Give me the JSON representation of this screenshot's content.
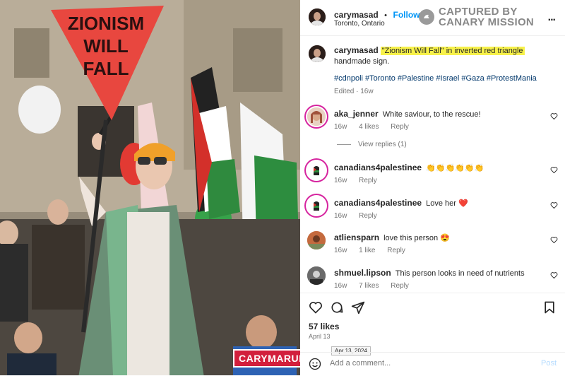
{
  "photo": {
    "sign_lines": [
      "ZIONISM",
      "WILL",
      "FALL"
    ],
    "watermark": "CARYMARULES"
  },
  "header": {
    "username": "carymasad",
    "separator": "•",
    "follow_label": "Follow",
    "location": "Toronto, Ontario",
    "canary_lines": [
      "CAPTURED BY",
      "CANARY MISSION"
    ],
    "more_label": "..."
  },
  "caption": {
    "username": "carymasad",
    "highlight": "\"Zionism Will Fall\" in inverted red triangle",
    "rest": " handmade sign.",
    "hashtags": "#cdnpoli #Toronto #Palestine #Israel #Gaza #ProtestMania",
    "edited": "Edited · 16w"
  },
  "comments": [
    {
      "user": "aka_jenner",
      "text": "White saviour, to the rescue!",
      "time": "16w",
      "likes": "4 likes",
      "reply": "Reply"
    },
    {
      "user": "canadians4palestinee",
      "text": "👏👏👏👏👏👏",
      "time": "16w",
      "likes": "",
      "reply": "Reply"
    },
    {
      "user": "canadians4palestinee",
      "text": "Love her ❤️",
      "time": "16w",
      "likes": "",
      "reply": "Reply"
    },
    {
      "user": "atliensparn",
      "text": "love this person 😍",
      "time": "16w",
      "likes": "1 like",
      "reply": "Reply"
    },
    {
      "user": "shmuel.lipson",
      "text": "This person looks in need of nutrients",
      "time": "16w",
      "likes": "7 likes",
      "reply": "Reply"
    }
  ],
  "view_replies": "View replies (1)",
  "likes": "57 likes",
  "date": "April 13",
  "date_tooltip": "Apr 13, 2024",
  "add_comment": {
    "placeholder": "Add a comment...",
    "post_label": "Post"
  },
  "icons": [
    "heart-icon",
    "comment-icon",
    "share-icon",
    "bookmark-icon",
    "emoji-icon",
    "more-icon",
    "canary-logo-icon"
  ],
  "colors": {
    "follow": "#0095f6",
    "highlight": "#f7f14a",
    "sign_red": "#e8473f",
    "watermark": "#d21f3c"
  }
}
